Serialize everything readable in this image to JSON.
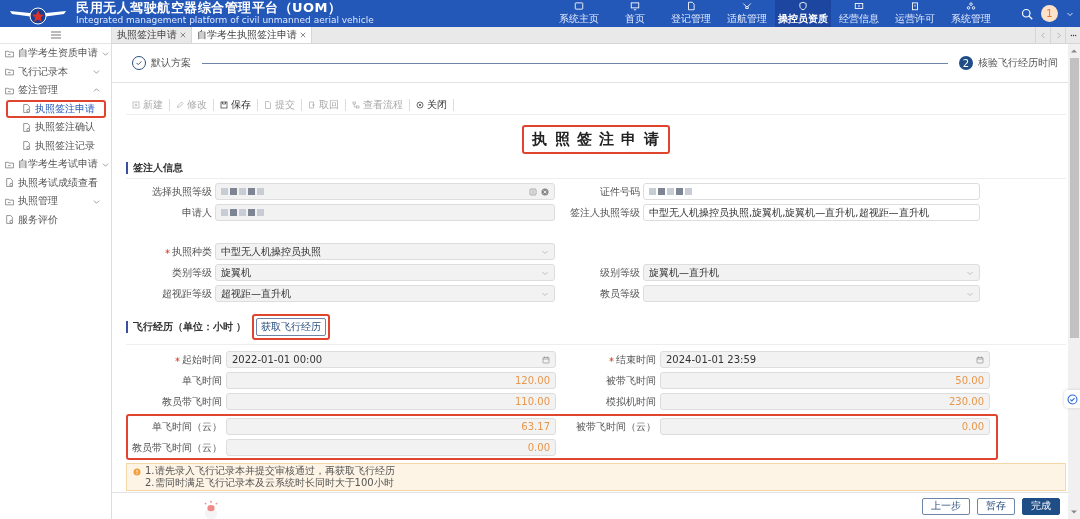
{
  "header": {
    "title": "民用无人驾驶航空器综合管理平台（UOM）",
    "subtitle": "Integrated management platform of civil unmanned aerial vehicle",
    "nav": [
      {
        "label": "系统主页",
        "selected": false
      },
      {
        "label": "首页",
        "selected": false
      },
      {
        "label": "登记管理",
        "selected": false
      },
      {
        "label": "适航管理",
        "selected": false
      },
      {
        "label": "操控员资质",
        "selected": true
      },
      {
        "label": "经营信息",
        "selected": false
      },
      {
        "label": "运营许可",
        "selected": false
      },
      {
        "label": "系统管理",
        "selected": false
      }
    ],
    "avatar": "1"
  },
  "sidebar": {
    "items": [
      {
        "label": "自学考生资质申请",
        "expanded": false
      },
      {
        "label": "飞行记录本",
        "expanded": false
      },
      {
        "label": "签注管理",
        "expanded": true,
        "children": [
          {
            "label": "执照签注申请",
            "selected": true,
            "highlighted": true
          },
          {
            "label": "执照签注确认",
            "selected": false,
            "highlighted": false
          },
          {
            "label": "执照签注记录",
            "selected": false,
            "highlighted": false
          }
        ]
      },
      {
        "label": "自学考生考试申请",
        "expanded": false
      },
      {
        "label": "执照考试成绩查看"
      },
      {
        "label": "执照管理",
        "expanded": false
      },
      {
        "label": "服务评价"
      }
    ]
  },
  "tabs": [
    {
      "label": "执照签注申请",
      "selected": false
    },
    {
      "label": "自学考生执照签注申请",
      "selected": true
    }
  ],
  "steps": [
    {
      "label": "默认方案",
      "done": true
    },
    {
      "number": "2",
      "label": "核验飞行经历时间",
      "done": false
    }
  ],
  "toolbar": [
    {
      "label": "新建",
      "disabled": true
    },
    {
      "label": "修改",
      "disabled": true
    },
    {
      "label": "保存",
      "disabled": false
    },
    {
      "label": "提交",
      "disabled": true
    },
    {
      "label": "取回",
      "disabled": true
    },
    {
      "label": "查看流程",
      "disabled": true
    },
    {
      "label": "关闭",
      "disabled": false
    }
  ],
  "form_title": {
    "text": "执 照 签 注 申 请",
    "highlighted": true
  },
  "signer_section": {
    "title": "签注人信息",
    "groups": [
      [
        {
          "left": {
            "label": "选择执照等级",
            "required": false,
            "kind": "picker",
            "readonly": true,
            "blurred": true
          },
          "right": {
            "label": "证件号码",
            "required": false,
            "kind": "input",
            "readonly": false,
            "blurred": true
          }
        },
        {
          "left": {
            "label": "申请人",
            "required": false,
            "kind": "input",
            "readonly": true,
            "blurred": true
          },
          "right": {
            "label": "签注人执照等级",
            "required": false,
            "kind": "input",
            "readonly": false,
            "value": "中型无人机操控员执照,旋翼机,旋翼机—直升机,超视距—直升机"
          }
        }
      ],
      [
        {
          "left": {
            "label": "执照种类",
            "required": true,
            "kind": "select",
            "readonly": true,
            "value": "中型无人机操控员执照"
          }
        },
        {
          "left": {
            "label": "类别等级",
            "required": false,
            "kind": "select",
            "readonly": true,
            "value": "旋翼机"
          },
          "right": {
            "label": "级别等级",
            "required": false,
            "kind": "select",
            "readonly": true,
            "value": "旋翼机—直升机"
          }
        },
        {
          "left": {
            "label": "超视距等级",
            "required": false,
            "kind": "select",
            "readonly": true,
            "value": "超视距—直升机"
          },
          "right": {
            "label": "教员等级",
            "required": false,
            "kind": "select",
            "readonly": true
          }
        }
      ]
    ]
  },
  "flight_section": {
    "title": "飞行经历（单位：小时 ）",
    "fetch_button": {
      "label": "获取飞行经历",
      "highlighted": true
    },
    "rows": [
      {
        "left": {
          "label": "起始时间",
          "required": true,
          "kind": "date",
          "value": "2022-01-01  00:00"
        },
        "right": {
          "label": "结束时间",
          "required": true,
          "kind": "date",
          "value": "2024-01-01  23:59"
        }
      },
      {
        "left": {
          "label": "单飞时间",
          "kind": "number",
          "value": "120.00"
        },
        "right": {
          "label": "被带飞时间",
          "kind": "number",
          "value": "50.00"
        }
      },
      {
        "left": {
          "label": "教员带飞时间",
          "kind": "number",
          "value": "110.00"
        },
        "right": {
          "label": "模拟机时间",
          "kind": "number",
          "value": "230.00"
        }
      }
    ],
    "cloud_rows": {
      "highlighted": true,
      "rows": [
        {
          "left": {
            "label": "单飞时间（云）",
            "kind": "number",
            "value": "63.17"
          },
          "right": {
            "label": "被带飞时间（云）",
            "kind": "number",
            "value": "0.00"
          }
        },
        {
          "left": {
            "label": "教员带飞时间（云）",
            "kind": "number",
            "value": "0.00"
          }
        }
      ]
    },
    "notice": [
      "1.请先录入飞行记录本并提交审核通过，再获取飞行经历",
      "2.需同时满足飞行记录本及云系统时长同时大于100小时"
    ]
  },
  "footer_buttons": [
    {
      "label": "上一步",
      "primary": false
    },
    {
      "label": "暂存",
      "primary": false
    },
    {
      "label": "完成",
      "primary": true
    }
  ]
}
